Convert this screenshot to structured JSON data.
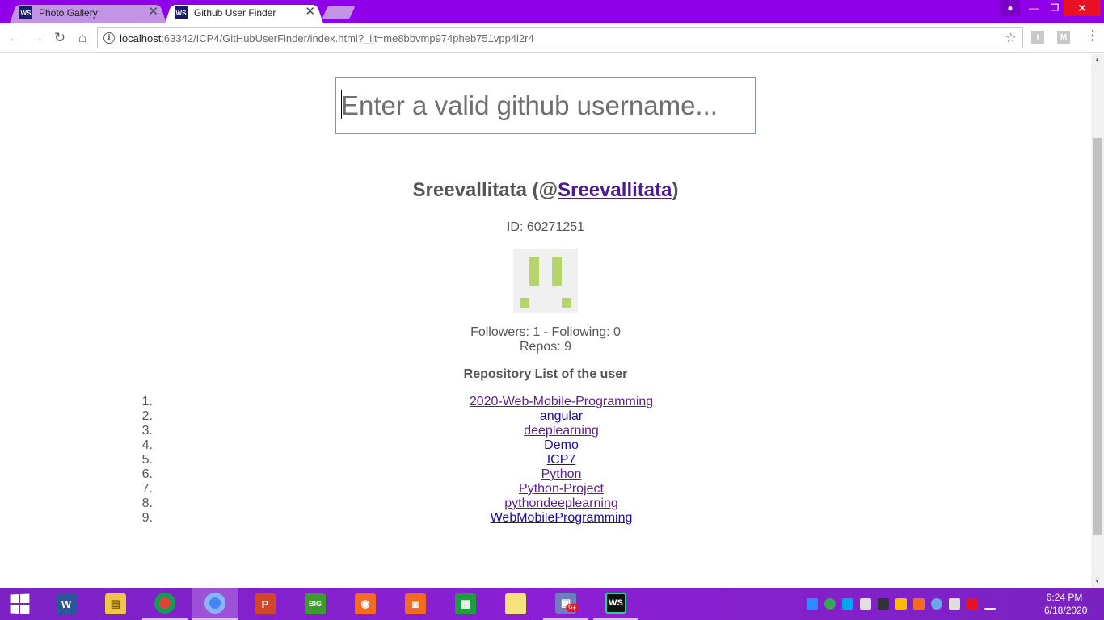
{
  "browser": {
    "tabs": [
      {
        "title": "Photo Gallery",
        "icon": "webstorm-icon",
        "active": false
      },
      {
        "title": "Github User Finder",
        "icon": "webstorm-icon",
        "active": true
      }
    ],
    "url_host": "localhost",
    "url_rest": ":63342/ICP4/GitHubUserFinder/index.html?_ijt=me8bbvmp974pheb751vpp4i2r4",
    "extensions": [
      "I",
      "M"
    ]
  },
  "page": {
    "search": {
      "placeholder": "Enter a valid github username...",
      "value": ""
    },
    "user": {
      "name": "Sreevallitata",
      "login": "Sreevallitata",
      "name_open": " (@",
      "name_close": ")",
      "id_text": "ID: 60271251",
      "stats_line1": "Followers: 1 - Following: 0",
      "stats_line2": "Repos: 9"
    },
    "repo_list_title": "Repository List of the user",
    "repos": [
      {
        "num": "1.",
        "name": "2020-Web-Mobile-Programming",
        "visited": true
      },
      {
        "num": "2.",
        "name": "angular",
        "visited": false
      },
      {
        "num": "3.",
        "name": "deeplearning",
        "visited": true
      },
      {
        "num": "4.",
        "name": "Demo",
        "visited": false
      },
      {
        "num": "5.",
        "name": "ICP7",
        "visited": false
      },
      {
        "num": "6.",
        "name": "Python",
        "visited": true
      },
      {
        "num": "7.",
        "name": "Python-Project",
        "visited": true
      },
      {
        "num": "8.",
        "name": "pythondeeplearning",
        "visited": true
      },
      {
        "num": "9.",
        "name": "WebMobileProgramming",
        "visited": false
      }
    ]
  },
  "taskbar": {
    "apps": [
      "windows-start",
      "word",
      "file-explorer",
      "chrome",
      "chrome-active",
      "powerpoint",
      "big-farm",
      "screenshot-tool",
      "camera",
      "store",
      "sticky-notes",
      "remote-desktop",
      "webstorm"
    ],
    "badge": "9+",
    "time": "6:24 PM",
    "date": "6/18/2020"
  },
  "colors": {
    "tab_strip": "#8f00e8",
    "taskbar": "#8b1fd6",
    "visited_link": "#5a1e8c",
    "link": "#1a0dab",
    "text": "#555555",
    "avatar_accent": "#b5d46a"
  }
}
